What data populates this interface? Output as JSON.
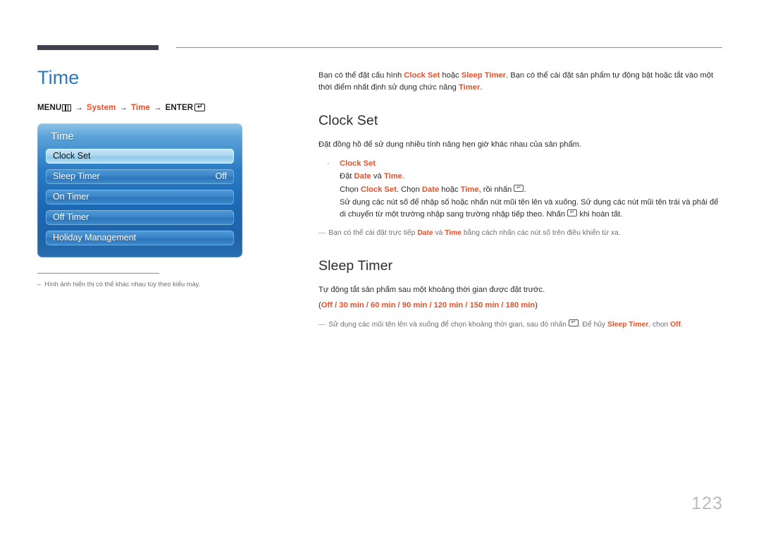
{
  "page": {
    "number": "123"
  },
  "left": {
    "title": "Time",
    "menu_path": {
      "menu_label": "MENU",
      "menu_icon": "menu-grid-icon",
      "arrow": "→",
      "step1": "System",
      "step2": "Time",
      "enter_label": "ENTER",
      "enter_icon": "enter-return-icon"
    },
    "osd": {
      "title": "Time",
      "rows": [
        {
          "label": "Clock Set",
          "value": "",
          "selected": true
        },
        {
          "label": "Sleep Timer",
          "value": "Off",
          "selected": false
        },
        {
          "label": "On Timer",
          "value": "",
          "selected": false
        },
        {
          "label": "Off Timer",
          "value": "",
          "selected": false
        },
        {
          "label": "Holiday Management",
          "value": "",
          "selected": false
        }
      ]
    },
    "note": {
      "dash": "–",
      "text": "Hình ảnh hiển thị có thể khác nhau tùy theo kiểu máy."
    }
  },
  "right": {
    "intro": {
      "part1": "Bạn có thể đặt cấu hình ",
      "kw1": "Clock Set",
      "part2": " hoặc ",
      "kw2": "Sleep Timer",
      "part3": ". Bạn có thể cài đặt sản phẩm tự động bật hoặc tắt vào một thời điểm nhất định sử dụng chức năng ",
      "kw3": "Timer",
      "part4": "."
    },
    "clock_set": {
      "heading": "Clock Set",
      "body": "Đặt đồng hồ để sử dụng nhiều tính năng hẹn giờ khác nhau của sản phẩm.",
      "bullet": {
        "dot": "·",
        "label": "Clock Set",
        "line1": {
          "a": "Đặt ",
          "kw1": "Date",
          "b": " và ",
          "kw2": "Time",
          "c": "."
        },
        "line2": {
          "a": "Chọn ",
          "kw1": "Clock Set",
          "b": ". Chọn ",
          "kw2": "Date",
          "c": " hoặc ",
          "kw3": "Time",
          "d": ", rồi nhấn ",
          "e": "."
        },
        "line3": "Sử dụng các nút số để nhập số hoặc nhấn nút mũi tên lên và xuống. Sử dụng các nút mũi tên trái và phải để di chuyển từ một trường nhập sang trường nhập tiếp theo. Nhấn ",
        "line3_tail": " khi hoàn tất."
      },
      "note": {
        "emdash": "—",
        "a": "Bạn có thể cài đặt trực tiếp ",
        "kw1": "Date",
        "b": " và ",
        "kw2": "Time",
        "c": " bằng cách nhấn các nút số trên điều khiển từ xa."
      }
    },
    "sleep_timer": {
      "heading": "Sleep Timer",
      "body": "Tự động tắt sản phẩm sau một khoảng thời gian được đặt trước.",
      "options_open": "(",
      "options": [
        "Off",
        "30 min",
        "60 min",
        "90 min",
        "120 min",
        "150 min",
        "180 min"
      ],
      "options_sep": " / ",
      "options_close": ")",
      "note": {
        "emdash": "—",
        "a": "Sử dụng các mũi tên lên và xuống để chọn khoảng thời gian, sau đó nhấn ",
        "b": ". Để hủy ",
        "kw1": "Sleep Timer",
        "c": ", chọn ",
        "kw2": "Off",
        "d": "."
      }
    }
  },
  "colors": {
    "accent_blue": "#2b7ac0",
    "keyword_orange": "#e8502a",
    "rule_dark": "#44414f",
    "note_gray": "#6f6d78"
  }
}
